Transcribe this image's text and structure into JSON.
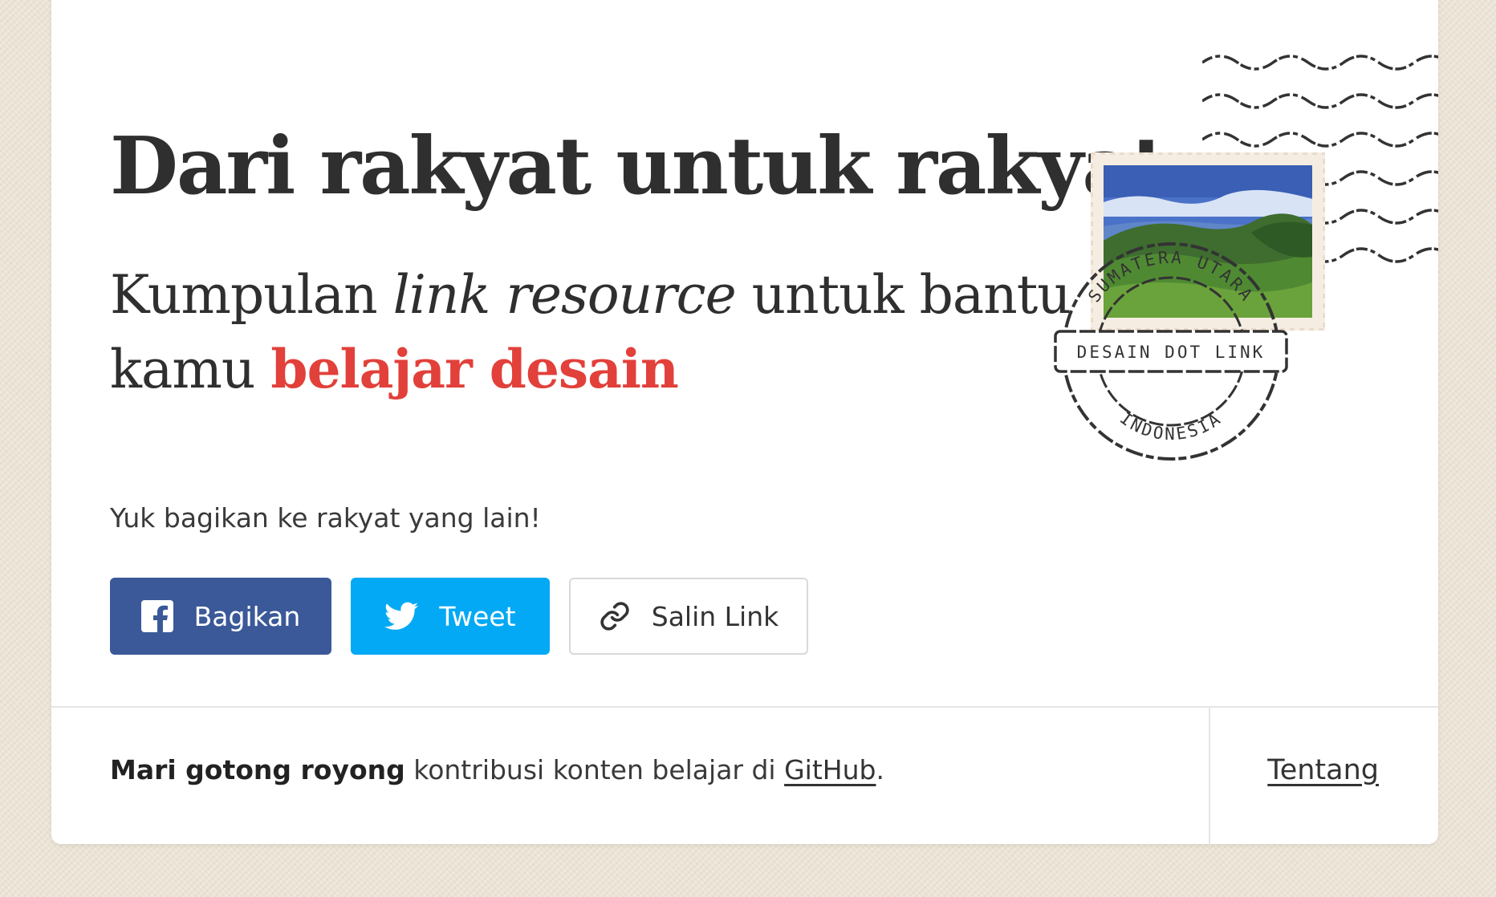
{
  "hero": {
    "title": "Dari rakyat untuk rakyat",
    "subtitle_part1": "Kumpulan ",
    "subtitle_italic": "link resource",
    "subtitle_part2": " untuk bantu kamu ",
    "subtitle_accent": "belajar desain"
  },
  "stamp": {
    "top_text": "SUMATERA UTARA",
    "band_text": "DESAIN DOT LINK",
    "bottom_text": "INDONESIA"
  },
  "share": {
    "label": "Yuk bagikan ke rakyat yang lain!",
    "facebook_label": "Bagikan",
    "twitter_label": "Tweet",
    "copy_label": "Salin Link"
  },
  "footer": {
    "bold_text": "Mari gotong royong",
    "middle_text": " kontribusi konten belajar di ",
    "link_text": "GitHub",
    "end_text": ".",
    "about_label": "Tentang"
  },
  "colors": {
    "accent": "#e2403a",
    "facebook": "#3b5998",
    "twitter": "#03a9f4",
    "background": "#ece4d6"
  }
}
